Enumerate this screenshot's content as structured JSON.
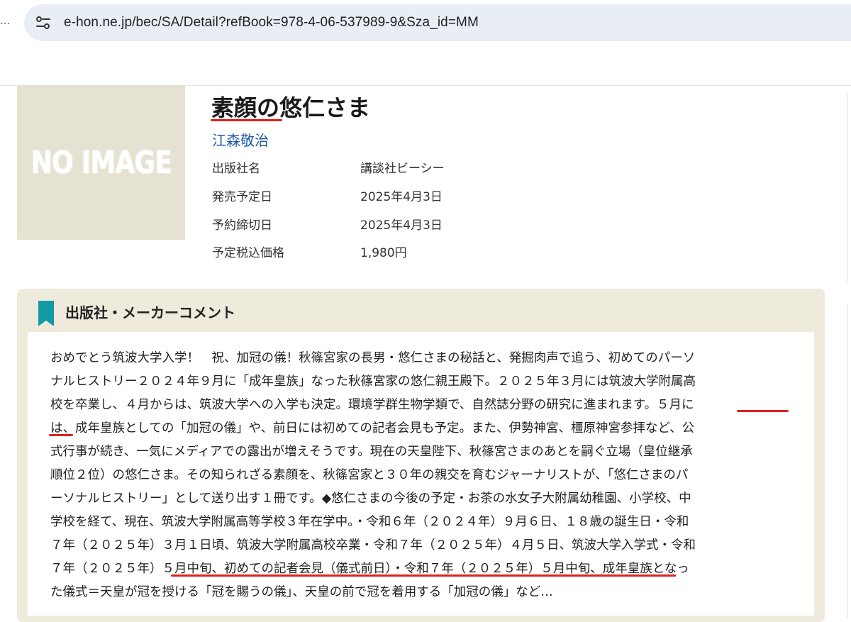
{
  "browser": {
    "url": "e-hon.ne.jp/bec/SA/Detail?refBook=978-4-06-537989-9&Sza_id=MM",
    "left_edge_mark": "…",
    "site_info_icon": "tune-icon"
  },
  "book": {
    "cover_text": "NO IMAGE",
    "title": "素顔の悠仁さま",
    "author": "江森敬治",
    "details": [
      {
        "label": "出版社名",
        "value": "講談社ビーシー"
      },
      {
        "label": "発売予定日",
        "value": "2025年4月3日"
      },
      {
        "label": "予約締切日",
        "value": "2025年4月3日"
      },
      {
        "label": "予定税込価格",
        "value": "1,980円"
      }
    ]
  },
  "comment": {
    "heading": "出版社・メーカーコメント",
    "icon": "bookmark-icon",
    "lines": [
      "おめでとう筑波大学入学！　祝、加冠の儀！秋篠宮家の長男・悠仁さまの秘話と、発掘肉声で追う、初めてのパーソ",
      "ナルヒストリー２０２４年９月に「成年皇族」なった秋篠宮家の悠仁親王殿下。２０２５年３月には筑波大学附属高",
      "校を卒業し、４月からは、筑波大学への入学も決定。環境学群生物学類で、自然誌分野の研究に進まれます。５月に",
      "は、成年皇族としての「加冠の儀」や、前日には初めての記者会見も予定。また、伊勢神宮、橿原神宮参拝など、公",
      "式行事が続き、一気にメディアでの露出が増えそうです。現在の天皇陛下、秋篠宮さまのあとを嗣ぐ立場（皇位継承",
      "順位２位）の悠仁さま。その知られざる素顔を、秋篠宮家と３０年の親交を育むジャーナリストが、「悠仁さまのパ",
      "ーソナルヒストリー」として送り出す１冊です。◆悠仁さまの今後の予定・お茶の水女子大附属幼稚園、小学校、中",
      "学校を経て、現在、筑波大学附属高等学校３年在学中。・令和６年（２０２４年）９月６日、１８歳の誕生日・令和",
      "７年（２０２５年）３月１日頃、筑波大学附属高校卒業・令和７年（２０２５年）４月５日、筑波大学入学式・令和",
      "７年（２０２５年）５月中旬、初めての記者会見（儀式前日）・令和７年（２０２５年）５月中旬、成年皇族となっ",
      "た儀式＝天皇が冠を授ける「冠を賜うの儀」、天皇の前で冠を着用する「加冠の儀」など…"
    ]
  },
  "colors": {
    "annotation_underline": "#e0201f",
    "panel_background": "#eeebdd",
    "bookmark_teal": "#139aa5",
    "author_link": "#1e5aa5"
  }
}
